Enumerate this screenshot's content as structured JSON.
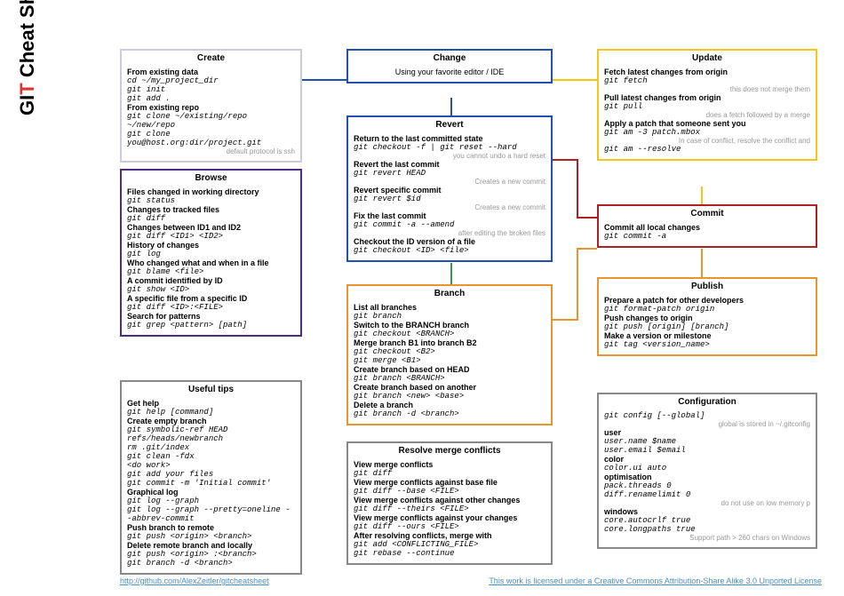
{
  "page_title_parts": {
    "g": "G",
    "i": "I",
    "t": "T",
    "rest": " Cheat Sheet"
  },
  "create": {
    "h": "Create",
    "l1": "From existing data",
    "c1": "cd ~/my_project_dir",
    "c2": "git init",
    "c3": "git add .",
    "l2": "From existing repo",
    "c4": "git clone ~/existing/repo ~/new/repo",
    "c5": "git clone you@host.org:dir/project.git",
    "n1": "default protocol is ssh"
  },
  "browse": {
    "h": "Browse",
    "l1": "Files changed in working directory",
    "c1": "git status",
    "l2": "Changes to tracked files",
    "c2": "git diff",
    "l3": "Changes between ID1 and ID2",
    "c3": "git diff <ID1> <ID2>",
    "l4": "History of changes",
    "c4": "git log",
    "l5": "Who changed what and when in a file",
    "c5": "git blame <file>",
    "l6": "A commit identified by ID",
    "c6": "git show <ID>",
    "l7": "A specific file from a specific ID",
    "c7": "git diff <ID>:<FILE>",
    "l8": "Search for patterns",
    "c8": "git grep <pattern> [path]"
  },
  "tips": {
    "h": "Useful tips",
    "l1": "Get help",
    "c1": "git help [command]",
    "l2": "Create empty branch",
    "c2": "git symbolic-ref HEAD refs/heads/newbranch",
    "c3": "rm .git/index",
    "c4": "git clean -fdx",
    "c5": "<do work>",
    "c6": "git add your files",
    "c7": "git commit -m 'Initial commit'",
    "l3": "Graphical log",
    "c8": "git log --graph",
    "c9": "git log --graph --pretty=oneline --abbrev-commit",
    "l4": "Push branch to remote",
    "c10": "git push <origin> <branch>",
    "l5": "Delete remote branch and locally",
    "c11": "git push <origin> :<branch>",
    "c12": "git branch -d <branch>"
  },
  "change": {
    "h": "Change",
    "l1": "Using your favorite editor / IDE"
  },
  "revert": {
    "h": "Revert",
    "l1": "Return to the last committed state",
    "c1": "git checkout -f | git reset --hard",
    "n1": "you cannot undo a hard reset",
    "l2": "Revert the last commit",
    "c2": "git revert HEAD",
    "n2": "Creates a new commit",
    "l3": "Revert specific commit",
    "c3": "git revert $id",
    "n3": "Creates a new commit",
    "l4": "Fix the last commit",
    "c4": "git commit -a --amend",
    "n4": "after editing the broken files",
    "l5": "Checkout the ID version of a file",
    "c5": "git checkout <ID> <file>"
  },
  "branch": {
    "h": "Branch",
    "l1": "List all branches",
    "c1": "git branch",
    "l2": "Switch to the BRANCH branch",
    "c2": "git checkout <BRANCH>",
    "l3": "Merge branch B1 into branch B2",
    "c3": "git checkout <B2>",
    "c4": "git merge <B1>",
    "l4": "Create branch based on HEAD",
    "c5": "git branch <BRANCH>",
    "l5": "Create branch based on another",
    "c6": "git branch <new> <base>",
    "l6": "Delete a branch",
    "c7": "git branch -d <branch>"
  },
  "resolve": {
    "h": "Resolve merge conflicts",
    "l1": "View merge conflicts",
    "c1": "git diff",
    "l2": "View merge conflicts against base file",
    "c2": "git diff --base <FILE>",
    "l3": "View merge conflicts against other changes",
    "c3": "git diff --theirs <FILE>",
    "l4": "View merge conflicts against your changes",
    "c4": "git diff --ours <FILE>",
    "l5": "After resolving conflicts, merge with",
    "c5": "git add <CONFLICTING_FILE>",
    "c6": "git rebase --continue"
  },
  "update": {
    "h": "Update",
    "l1": "Fetch latest changes from origin",
    "c1": "git fetch",
    "n1": "this does not merge them",
    "l2": "Pull latest changes from origin",
    "c2": "git pull",
    "n2": "does a fetch followed by a merge",
    "l3": "Apply a patch that someone sent you",
    "c3": "git am -3 patch.mbox",
    "n3": "In case of conflict, resolve the conflict and",
    "c4": "git am --resolve"
  },
  "commit": {
    "h": "Commit",
    "l1": "Commit all local changes",
    "c1": "git commit -a"
  },
  "publish": {
    "h": "Publish",
    "l1": "Prepare a patch for other developers",
    "c1": "git format-patch origin",
    "l2": "Push changes to origin",
    "c2": "git push [origin] [branch]",
    "l3": "Make a version or milestone",
    "c3": "git tag <version_name>"
  },
  "config": {
    "h": "Configuration",
    "c1": "git config [--global]",
    "n1": "global is stored in ~/.gitconfig",
    "l2": "user",
    "c2": "user.name $name",
    "c3": "user.email $email",
    "l3": "color",
    "c4": "color.ui auto",
    "l4": "optimisation",
    "c5": "pack.threads 0",
    "c6": "diff.renamelimit 0",
    "n2": "do not use on low memory p",
    "l5": "windows",
    "c7": "core.autocrlf true",
    "c8": "core.longpaths true",
    "n3": "Support path > 260 chars on Windows"
  },
  "footer": {
    "link": "http://github.com/AlexZeitler/gitcheatsheet",
    "license": "This work is licensed under a Creative Commons Attribution-Share Alike 3.0 Unported License"
  },
  "colors": {
    "create": "#d0c9de",
    "browse": "#4b2d7f",
    "tips": "#888",
    "change": "#2050b0",
    "revert": "#2050b0",
    "branch": "#e8952f",
    "resolve": "#888",
    "update": "#f5c518",
    "commit": "#b02020",
    "publish": "#e8952f",
    "config": "#888",
    "green": "#3a9b35"
  }
}
